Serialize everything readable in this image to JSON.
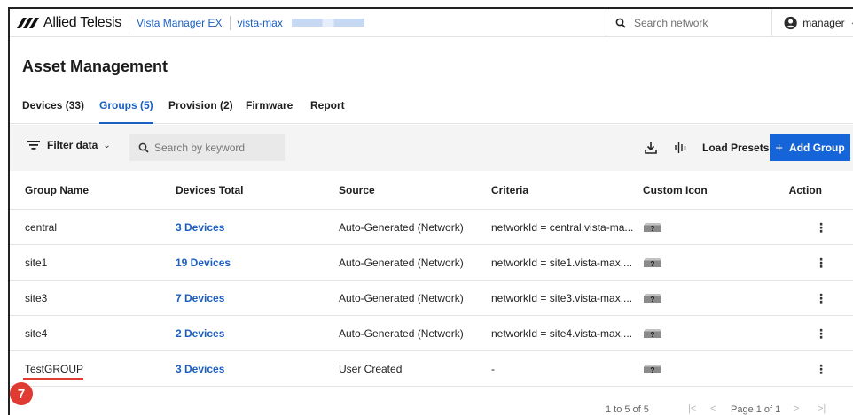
{
  "topbar": {
    "brand": "Allied Telesis",
    "product": "Vista Manager EX",
    "server": "vista-max",
    "search_placeholder": "Search network",
    "user": "manager"
  },
  "page": {
    "title": "Asset Management"
  },
  "tabs": [
    {
      "label": "Devices (33)"
    },
    {
      "label": "Groups (5)"
    },
    {
      "label": "Provision (2)"
    },
    {
      "label": "Firmware"
    },
    {
      "label": "Report"
    }
  ],
  "toolbar": {
    "filter_label": "Filter data",
    "search_placeholder": "Search by keyword",
    "load_presets": "Load Presets",
    "add_group": "Add Group",
    "add_plus": "+"
  },
  "table": {
    "headers": [
      "Group Name",
      "Devices Total",
      "Source",
      "Criteria",
      "Custom Icon",
      "Action"
    ],
    "rows": [
      {
        "name": "central",
        "devices": "3 Devices",
        "source": "Auto-Generated (Network)",
        "criteria": "networkId = central.vista-ma..."
      },
      {
        "name": "site1",
        "devices": "19 Devices",
        "source": "Auto-Generated (Network)",
        "criteria": "networkId = site1.vista-max...."
      },
      {
        "name": "site3",
        "devices": "7 Devices",
        "source": "Auto-Generated (Network)",
        "criteria": "networkId = site3.vista-max...."
      },
      {
        "name": "site4",
        "devices": "2 Devices",
        "source": "Auto-Generated (Network)",
        "criteria": "networkId = site4.vista-max...."
      },
      {
        "name": "TestGROUP",
        "devices": "3 Devices",
        "source": "User Created",
        "criteria": "-"
      }
    ],
    "action_glyph": "⋮"
  },
  "pagination": {
    "count": "1 to 5 of 5",
    "page_text": "Page 1 of 1",
    "first": "|<",
    "prev": "<",
    "next": ">",
    "last": ">|"
  },
  "annotation": {
    "step": "7"
  },
  "colors": {
    "accent": "#1565d8",
    "link": "#1a5fc2",
    "annotation": "#e03b33"
  },
  "icons": [
    "allied-telesis-logo-icon",
    "search-icon",
    "user-account-icon",
    "chevron-down-icon",
    "filter-icon",
    "export-icon",
    "columns-icon",
    "plus-icon",
    "unknown-device-icon",
    "kebab-menu-icon"
  ]
}
